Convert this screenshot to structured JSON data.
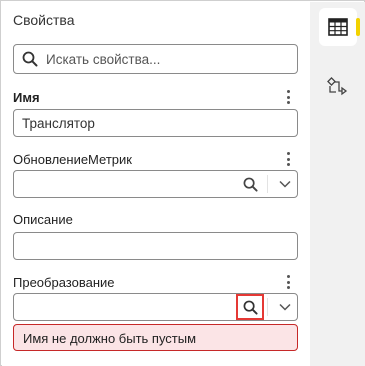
{
  "panel": {
    "title": "Свойства",
    "search_placeholder": "Искать свойства..."
  },
  "fields": [
    {
      "label": "Имя",
      "value": "Транслятор",
      "required": true
    },
    {
      "label": "ОбновлениеМетрик",
      "value": ""
    },
    {
      "label": "Описание",
      "value": ""
    },
    {
      "label": "Преобразование",
      "value": "",
      "error": "Имя не должно быть пустым"
    }
  ],
  "rail": {
    "tabs": [
      {
        "icon": "table-icon",
        "active": true
      },
      {
        "icon": "transform-icon",
        "active": false
      }
    ],
    "accent": "#f2d200"
  },
  "colors": {
    "error_bg": "#fbe4e6",
    "error_border": "#c62828",
    "highlight": "#e53935"
  }
}
